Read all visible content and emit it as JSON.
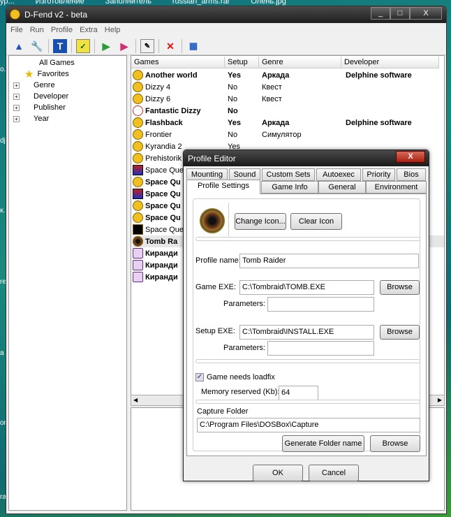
{
  "desktop": {
    "top_labels": [
      "ур...",
      "Изготовление",
      "Заполнитель",
      "russian_arms.rar",
      "Олень.jpg"
    ],
    "side_labels": [
      "о.",
      "dj",
      "к.",
      "re",
      "a",
      "or",
      "ra"
    ]
  },
  "app": {
    "title": "D-Fend v2 - beta",
    "menu": [
      "File",
      "Run",
      "Profile",
      "Extra",
      "Help"
    ]
  },
  "tree": {
    "items": [
      "All Games",
      "Favorites",
      "Genre",
      "Developer",
      "Publisher",
      "Year"
    ]
  },
  "list": {
    "columns": [
      "Games",
      "Setup",
      "Genre",
      "Developer"
    ],
    "rows": [
      {
        "name": "Another world",
        "setup": "Yes",
        "genre": "Аркада",
        "developer": "Delphine software",
        "bold": true
      },
      {
        "name": "Dizzy 4",
        "setup": "No",
        "genre": "Квест",
        "developer": ""
      },
      {
        "name": "Dizzy 6",
        "setup": "No",
        "genre": "Квест",
        "developer": ""
      },
      {
        "name": "Fantastic Dizzy",
        "setup": "No",
        "genre": "",
        "developer": "",
        "bold": true
      },
      {
        "name": "Flashback",
        "setup": "Yes",
        "genre": "Аркада",
        "developer": "Delphine software",
        "bold": true
      },
      {
        "name": "Frontier",
        "setup": "No",
        "genre": "Симулятор",
        "developer": ""
      },
      {
        "name": "Kyrandia 2",
        "setup": "Yes",
        "genre": "",
        "developer": ""
      },
      {
        "name": "Prehistorik",
        "setup": "",
        "genre": "",
        "developer": ""
      },
      {
        "name": "Space Que",
        "setup": "",
        "genre": "",
        "developer": ""
      },
      {
        "name": "Space Qu",
        "setup": "",
        "genre": "",
        "developer": "",
        "bold": true
      },
      {
        "name": "Space Qu",
        "setup": "",
        "genre": "",
        "developer": "",
        "bold": true
      },
      {
        "name": "Space Qu",
        "setup": "",
        "genre": "",
        "developer": "",
        "bold": true
      },
      {
        "name": "Space Qu",
        "setup": "",
        "genre": "",
        "developer": "",
        "bold": true
      },
      {
        "name": "Space Que",
        "setup": "",
        "genre": "",
        "developer": ""
      },
      {
        "name": "Tomb Ra",
        "setup": "",
        "genre": "",
        "developer": "",
        "bold": true,
        "selected": true
      },
      {
        "name": "Киранди",
        "setup": "",
        "genre": "",
        "developer": "",
        "bold": true
      },
      {
        "name": "Киранди",
        "setup": "",
        "genre": "",
        "developer": "",
        "bold": true
      },
      {
        "name": "Киранди",
        "setup": "",
        "genre": "",
        "developer": "",
        "bold": true
      }
    ]
  },
  "dialog": {
    "title": "Profile Editor",
    "close": "X",
    "tabs_row1": [
      "Mounting",
      "Sound",
      "Custom Sets",
      "Autoexec",
      "Priority",
      "Bios"
    ],
    "tabs_row2": [
      "Profile Settings",
      "Game Info",
      "General",
      "Environment"
    ],
    "change_icon": "Change Icon...",
    "clear_icon": "Clear Icon",
    "profile_name_label": "Profile name:",
    "profile_name": "Tomb Raider",
    "game_exe_label": "Game EXE:",
    "game_exe": "C:\\Tombraid\\TOMB.EXE",
    "parameters_label": "Parameters:",
    "game_params": "",
    "setup_exe_label": "Setup EXE:",
    "setup_exe": "C:\\Tombraid\\INSTALL.EXE",
    "setup_params": "",
    "browse": "Browse",
    "loadfix_label": "Game needs loadfix",
    "loadfix_checked": true,
    "memory_label": "Memory reserved (Kb):",
    "memory": "64",
    "capture_label": "Capture Folder",
    "capture_folder": "C:\\Program Files\\DOSBox\\Capture",
    "generate": "Generate Folder name",
    "ok": "OK",
    "cancel": "Cancel"
  }
}
